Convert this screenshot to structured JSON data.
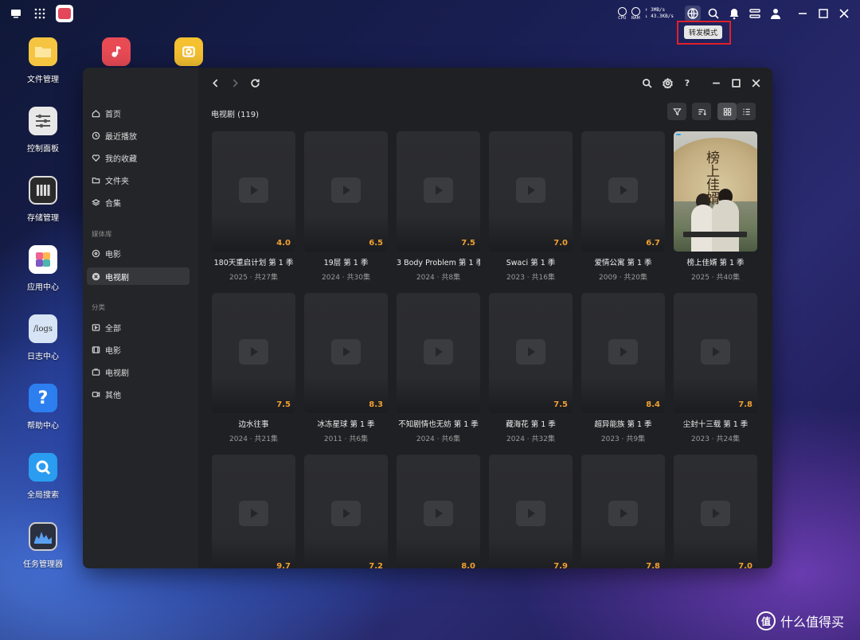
{
  "desktop": {
    "icons": [
      {
        "label": "文件管理",
        "icon": "folder-icon",
        "color": "#f5c542"
      },
      {
        "label": "控制面板",
        "icon": "control-panel-icon",
        "color": "#e8e8e8"
      },
      {
        "label": "存储管理",
        "icon": "storage-icon",
        "color": "#2a2a2a"
      },
      {
        "label": "应用中心",
        "icon": "app-center-icon",
        "color": "#ffffff"
      },
      {
        "label": "日志中心",
        "icon": "logs-icon",
        "color": "#d6e4f5",
        "glyph": "/logs"
      },
      {
        "label": "帮助中心",
        "icon": "help-icon",
        "color": "#2d7ff0",
        "glyph": "?"
      },
      {
        "label": "全局搜索",
        "icon": "search-app-icon",
        "color": "#2a9df0"
      },
      {
        "label": "任务管理器",
        "icon": "task-manager-icon",
        "color": "#2b3040"
      }
    ],
    "top_apps": [
      {
        "icon": "music-app-icon",
        "color": "#e94b55"
      },
      {
        "icon": "backup-app-icon",
        "color": "#f5c130"
      }
    ]
  },
  "topbar": {
    "stats": {
      "cpu": "CPU",
      "ram": "RAM",
      "up": "↑ 3MB/s",
      "down": "↓ 43.3KB/s"
    },
    "tooltip": "转发模式"
  },
  "sidebar": {
    "items": [
      {
        "label": "首页",
        "icon": "home-icon"
      },
      {
        "label": "最近播放",
        "icon": "clock-icon"
      },
      {
        "label": "我的收藏",
        "icon": "heart-icon"
      },
      {
        "label": "文件夹",
        "icon": "folder-icon"
      },
      {
        "label": "合集",
        "icon": "layers-icon"
      }
    ],
    "section_media": "媒体库",
    "media_items": [
      {
        "label": "电影",
        "icon": "movie-icon"
      },
      {
        "label": "电视剧",
        "icon": "tv-icon",
        "active": true
      }
    ],
    "section_category": "分类",
    "category_items": [
      {
        "label": "全部",
        "icon": "play-square-icon"
      },
      {
        "label": "电影",
        "icon": "film-icon"
      },
      {
        "label": "电视剧",
        "icon": "tv-icon"
      },
      {
        "label": "其他",
        "icon": "camera-icon"
      }
    ]
  },
  "main": {
    "title": "电视剧 (119)",
    "accent_rating": "#f0a030",
    "items": [
      {
        "name": "180天重启计划 第 1 季",
        "year": "2025",
        "episodes": "共27集",
        "rating": "4.0"
      },
      {
        "name": "19层 第 1 季",
        "year": "2024",
        "episodes": "共30集",
        "rating": "6.5"
      },
      {
        "name": "3 Body Problem 第 1 季",
        "year": "2024",
        "episodes": "共8集",
        "rating": "7.5"
      },
      {
        "name": "Swaci 第 1 季",
        "year": "2023",
        "episodes": "共16集",
        "rating": "7.0"
      },
      {
        "name": "爱情公寓 第 1 季",
        "year": "2009",
        "episodes": "共20集",
        "rating": "6.7"
      },
      {
        "name": "榜上佳婿 第 1 季",
        "year": "2025",
        "episodes": "共40集",
        "rating": "",
        "poster": "榜上佳婿"
      },
      {
        "name": "边水往事",
        "year": "2024",
        "episodes": "共21集",
        "rating": "7.5"
      },
      {
        "name": "冰冻星球 第 1 季",
        "year": "2011",
        "episodes": "共6集",
        "rating": "8.3"
      },
      {
        "name": "不知剧情也无妨 第 1 季",
        "year": "2024",
        "episodes": "共6集",
        "rating": ""
      },
      {
        "name": "藏海花 第 1 季",
        "year": "2024",
        "episodes": "共32集",
        "rating": "7.5"
      },
      {
        "name": "超异能族 第 1 季",
        "year": "2023",
        "episodes": "共9集",
        "rating": "8.4"
      },
      {
        "name": "尘封十三载 第 1 季",
        "year": "2023",
        "episodes": "共24集",
        "rating": "7.8"
      },
      {
        "name": "",
        "year": "",
        "episodes": "",
        "rating": "9.7"
      },
      {
        "name": "",
        "year": "",
        "episodes": "",
        "rating": "7.2"
      },
      {
        "name": "",
        "year": "",
        "episodes": "",
        "rating": "8.0"
      },
      {
        "name": "",
        "year": "",
        "episodes": "",
        "rating": "7.9"
      },
      {
        "name": "",
        "year": "",
        "episodes": "",
        "rating": "7.8"
      },
      {
        "name": "",
        "year": "",
        "episodes": "",
        "rating": "7.0"
      }
    ]
  },
  "watermark": {
    "glyph": "值",
    "text": "什么值得买"
  }
}
